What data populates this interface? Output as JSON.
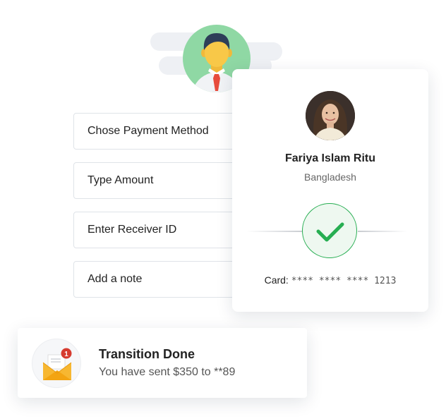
{
  "sender": {
    "avatar_icon": "person-avatar-icon"
  },
  "form": {
    "fields": [
      {
        "placeholder": "Chose Payment Method"
      },
      {
        "placeholder": "Type Amount"
      },
      {
        "placeholder": "Enter Receiver ID"
      },
      {
        "placeholder": "Add a note"
      }
    ]
  },
  "receiver": {
    "name": "Fariya Islam Ritu",
    "country": "Bangladesh",
    "card_label": "Card:",
    "card_number": "**** **** **** 1213",
    "status_icon": "check-icon",
    "success_color": "#27ae52"
  },
  "notification": {
    "title": "Transition Done",
    "message": "You have sent $350 to **89",
    "badge_count": "1",
    "icon": "envelope-icon",
    "icon_color": "#f7b731",
    "badge_color": "#d63b2f"
  }
}
